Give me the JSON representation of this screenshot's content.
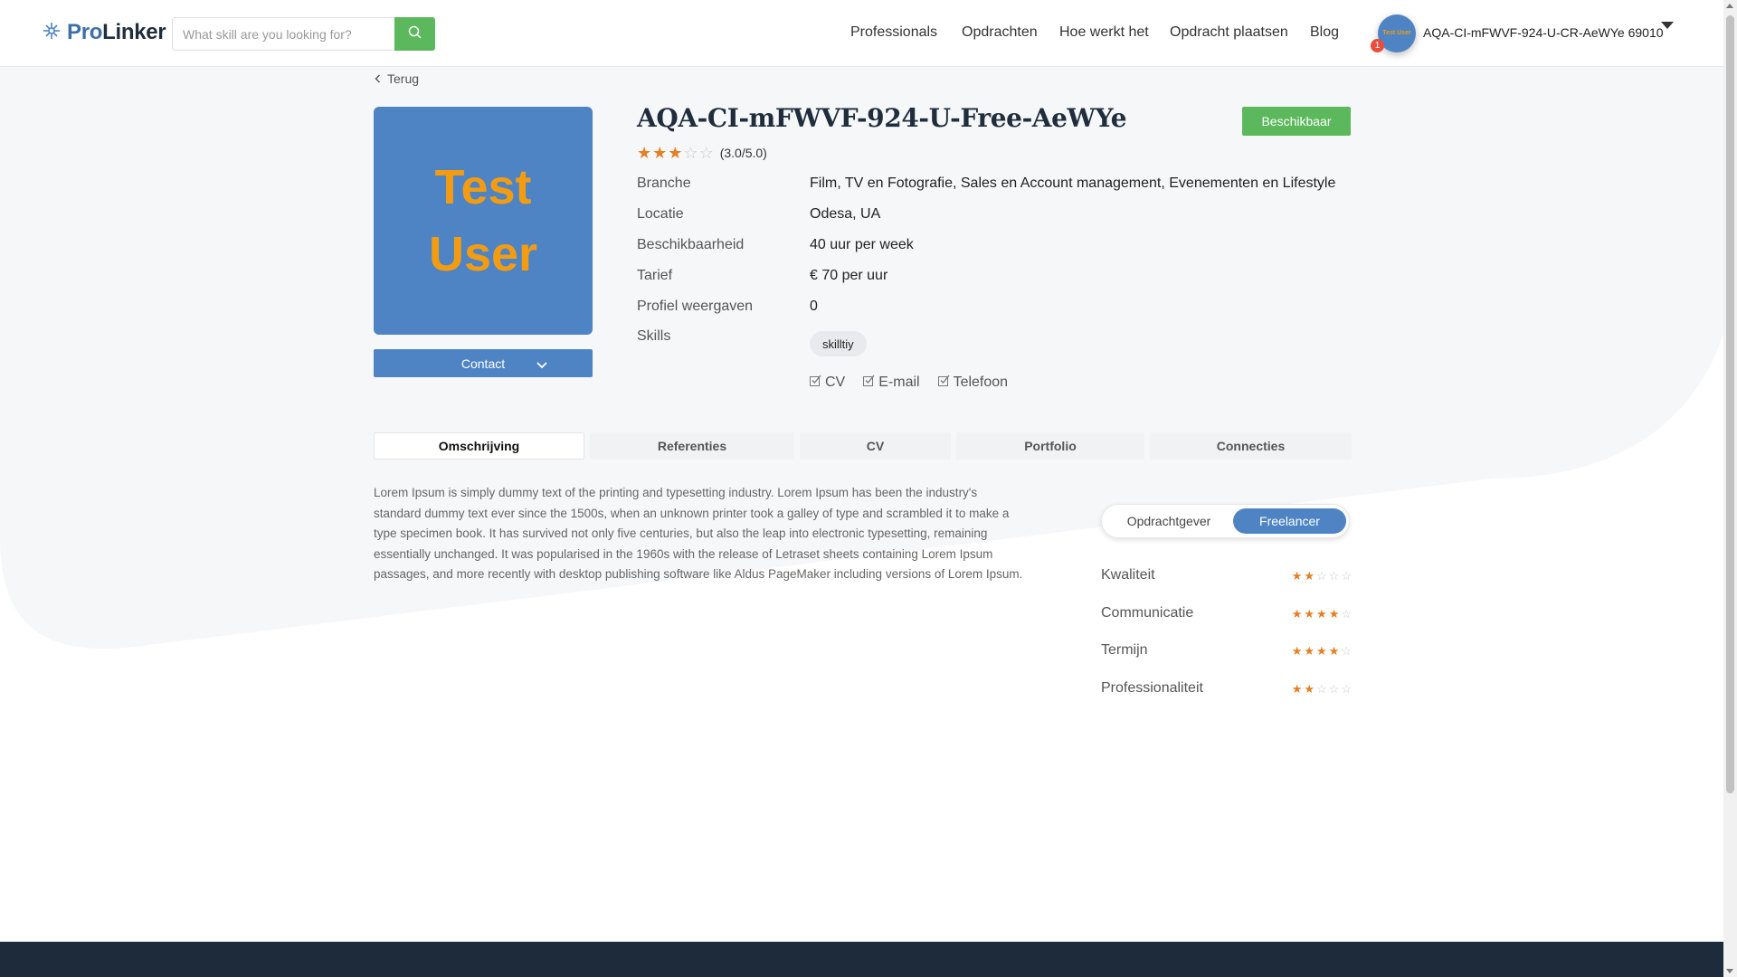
{
  "header": {
    "logo": {
      "pro": "Pro",
      "linker": "Linker"
    },
    "search_placeholder": "What skill are you looking for?",
    "nav": [
      "Professionals",
      "Opdrachten",
      "Hoe werkt het",
      "Opdracht plaatsen",
      "Blog"
    ],
    "notification_count": "1",
    "avatar_text": "Test User",
    "username": "AQA-CI-mFWVF-924-U-CR-AeWYe 69010"
  },
  "profile": {
    "back_label": "Terug",
    "image_text": [
      "Test",
      "User"
    ],
    "contact_label": "Contact",
    "name": "AQA-CI-mFWVF-924-U-Free-AeWYe",
    "status": "Beschikbaar",
    "rating": {
      "value": 3,
      "max": 5,
      "text": "(3.0/5.0)"
    },
    "info": [
      {
        "label": "Branche",
        "value": "Film, TV en Fotografie, Sales en Account management, Evenementen en Lifestyle"
      },
      {
        "label": "Locatie",
        "value": "Odesa, UA"
      },
      {
        "label": "Beschikbaarheid",
        "value": "40 uur per week"
      },
      {
        "label": "Tarief",
        "value": "€ 70 per uur"
      },
      {
        "label": "Profiel weergaven",
        "value": "0"
      },
      {
        "label": "Skills",
        "value": ""
      }
    ],
    "skills": [
      "skilltiy"
    ],
    "documents": [
      "CV",
      "E-mail",
      "Telefoon"
    ]
  },
  "tabs": [
    {
      "label": "Omschrijving",
      "active": true
    },
    {
      "label": "Referenties",
      "active": false
    },
    {
      "label": "CV",
      "active": false
    },
    {
      "label": "Portfolio",
      "active": false
    },
    {
      "label": "Connecties",
      "active": false
    }
  ],
  "description": "Lorem Ipsum is simply dummy text of the printing and typesetting industry. Lorem Ipsum has been the industry's standard dummy text ever since the 1500s, when an unknown printer took a galley of type and scrambled it to make a type specimen book. It has survived not only five centuries, but also the leap into electronic typesetting, remaining essentially unchanged. It was popularised in the 1960s with the release of Letraset sheets containing Lorem Ipsum passages, and more recently with desktop publishing software like Aldus PageMaker including versions of Lorem Ipsum.",
  "reviews": {
    "toggle": {
      "left": "Opdrachtgever",
      "right": "Freelancer",
      "selected": "Freelancer"
    },
    "criteria": [
      {
        "label": "Kwaliteit",
        "stars": 2
      },
      {
        "label": "Communicatie",
        "stars": 4
      },
      {
        "label": "Termijn",
        "stars": 4
      },
      {
        "label": "Professionaliteit",
        "stars": 2
      }
    ]
  },
  "colors": {
    "accent": "#4f84c4",
    "green": "#5cb85c",
    "star": "#e67e22",
    "footer": "#1d2b3a"
  }
}
